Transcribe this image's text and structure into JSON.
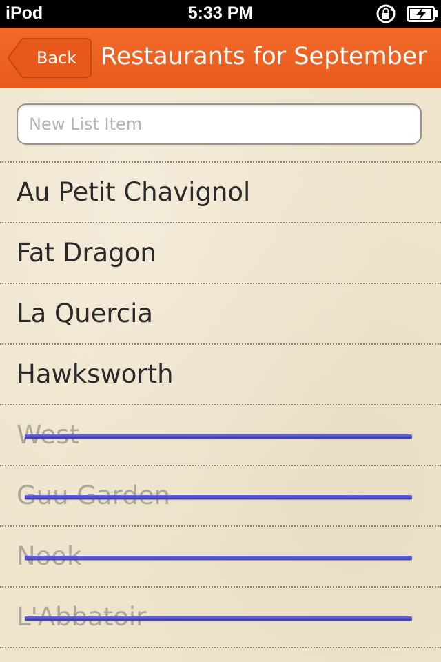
{
  "status_bar": {
    "carrier": "iPod",
    "time": "5:33 PM",
    "icons": [
      "rotation-lock-icon",
      "battery-charging-icon"
    ]
  },
  "nav": {
    "back_label": "Back",
    "title": "Restaurants for September",
    "color": "#ee6324"
  },
  "new_item": {
    "placeholder": "New List Item",
    "value": ""
  },
  "items": [
    {
      "label": "Au Petit Chavignol",
      "done": false
    },
    {
      "label": "Fat Dragon",
      "done": false
    },
    {
      "label": "La Quercia",
      "done": false
    },
    {
      "label": "Hawksworth",
      "done": false
    },
    {
      "label": "West",
      "done": true
    },
    {
      "label": "Guu Garden",
      "done": true
    },
    {
      "label": "Nook",
      "done": true
    },
    {
      "label": "L'Abbatoir",
      "done": true
    }
  ],
  "colors": {
    "strike": "#4a4ad0",
    "paper": "#efe5cd",
    "done_text": "#aba89c"
  }
}
